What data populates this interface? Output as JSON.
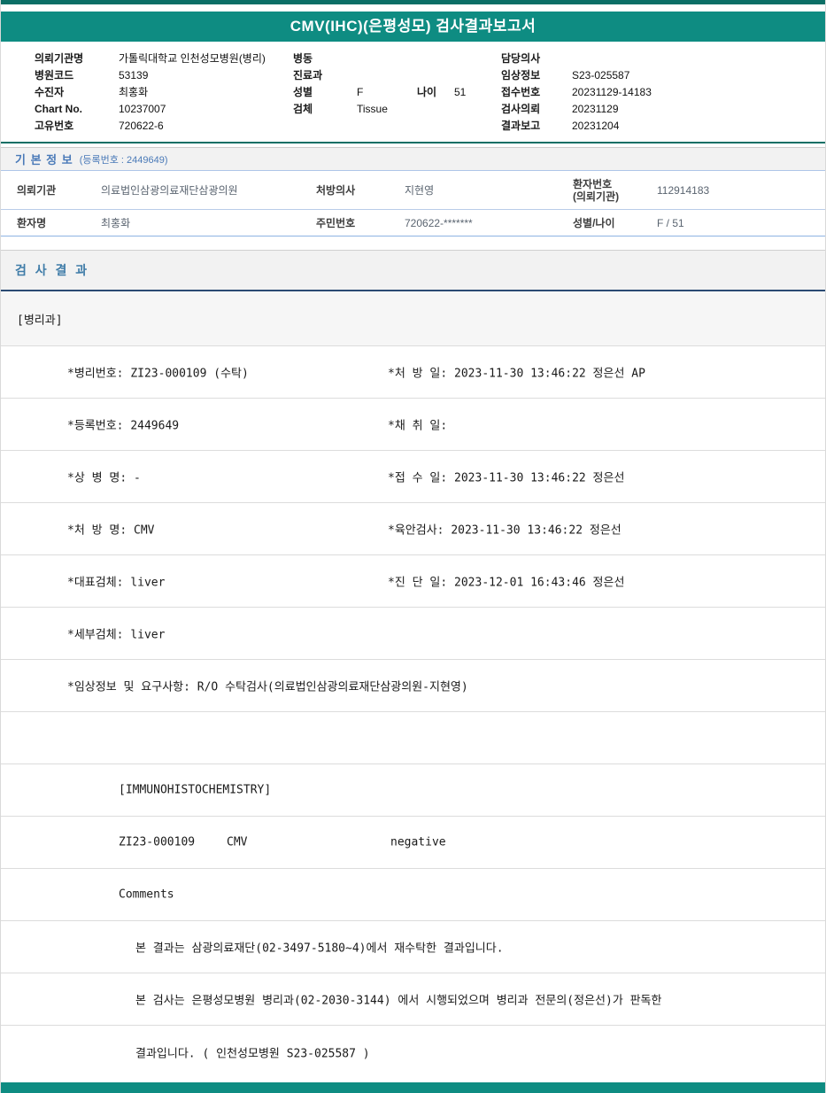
{
  "title": "CMV(IHC)(은평성모) 검사결과보고서",
  "patient_header": {
    "left": [
      {
        "label": "의뢰기관명",
        "value": "가톨릭대학교 인천성모병원(병리)"
      },
      {
        "label": "병원코드",
        "value": "53139"
      },
      {
        "label": "수진자",
        "value": "최홍화"
      },
      {
        "label": "Chart No.",
        "value": "10237007"
      },
      {
        "label": "고유번호",
        "value": "720622-6"
      }
    ],
    "middle": {
      "ward_label": "병동",
      "ward_value": "",
      "dept_label": "진료과",
      "dept_value": "",
      "sex_label": "성별",
      "sex_value": "F",
      "age_label": "나이",
      "age_value": "51",
      "specimen_label": "검체",
      "specimen_value": "Tissue"
    },
    "right": [
      {
        "label": "담당의사",
        "value": ""
      },
      {
        "label": "임상정보",
        "value": "S23-025587"
      },
      {
        "label": "접수번호",
        "value": "20231129-14183"
      },
      {
        "label": "검사의뢰",
        "value": "20231129"
      },
      {
        "label": "결과보고",
        "value": "20231204"
      }
    ]
  },
  "basic_info": {
    "title": "기 본 정 보",
    "registration": "(등록번호 : 2449649)",
    "row1": {
      "label1": "의뢰기관",
      "value1": "의료법인삼광의료재단삼광의원",
      "label2": "처방의사",
      "value2": "지현영",
      "label3_line1": "환자번호",
      "label3_line2": "(의뢰기관)",
      "value3": "112914183"
    },
    "row2": {
      "label1": "환자명",
      "value1": "최홍화",
      "label2": "주민번호",
      "value2": "720622-*******",
      "label3": "성별/나이",
      "value3": "F / 51"
    }
  },
  "test_result": {
    "title": "검 사 결 과",
    "department": "[병리과]",
    "rows": [
      {
        "left": "*병리번호: ZI23-000109 (수탁)",
        "right": "*처 방 일: 2023-11-30 13:46:22 정은선 AP"
      },
      {
        "left": "*등록번호: 2449649",
        "right": "*채 취 일:"
      },
      {
        "left": "*상 병 명: -",
        "right": "*접 수 일: 2023-11-30 13:46:22 정은선"
      },
      {
        "left": "*처 방 명: CMV",
        "right": "*육안검사: 2023-11-30 13:46:22 정은선"
      },
      {
        "left": "*대표검체: liver",
        "right": "*진 단 일: 2023-12-01 16:43:46 정은선"
      },
      {
        "left": "*세부검체: liver",
        "right": ""
      },
      {
        "left": "*임상정보 및 요구사항: R/O 수탁검사(의료법인삼광의료재단삼광의원-지현영)",
        "right": ""
      }
    ],
    "ihc_header": "[IMMUNOHISTOCHEMISTRY]",
    "ihc_result": {
      "code": "ZI23-000109",
      "test_name": "CMV",
      "value": "negative"
    },
    "comments_label": "Comments",
    "comments": [
      "본 결과는 삼광의료재단(02-3497-5180~4)에서 재수탁한 결과입니다.",
      "본 검사는 은평성모병원 병리과(02-2030-3144) 에서 시행되었으며 병리과 전문의(정은선)가 판독한",
      "결과입니다. ( 인천성모병원 S23-025587 )"
    ]
  },
  "colors": {
    "teal": "#0e8c82",
    "dark_teal": "#0c6f66",
    "navy_rule": "#2a4a73",
    "section_blue": "#4a7ab8",
    "result_title_blue": "#3f7ca8"
  }
}
